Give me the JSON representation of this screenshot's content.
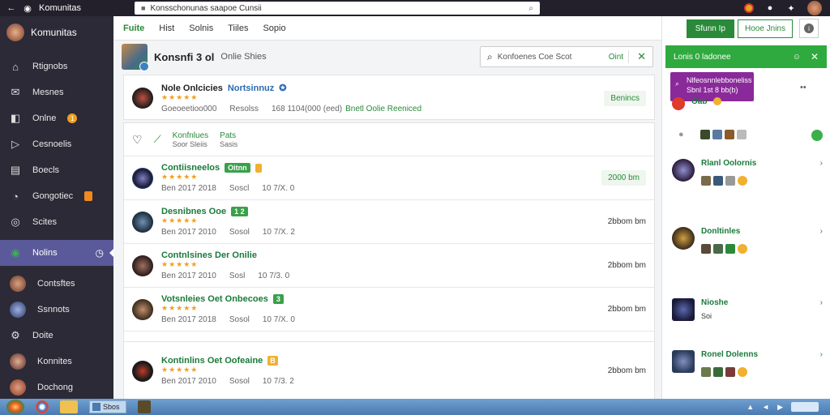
{
  "topbar": {
    "app_title": "Komunitas",
    "url": "Konsschonunas saapoe Cunsii"
  },
  "sidebar": {
    "user_name": "Komunitas",
    "items": [
      {
        "label": "Rtignobs",
        "icon": "home-icon"
      },
      {
        "label": "Mesnes",
        "icon": "message-icon"
      },
      {
        "label": "Onlne",
        "icon": "chat-icon",
        "badge": "1"
      },
      {
        "label": "Cesnoelis",
        "icon": "play-icon"
      },
      {
        "label": "Boecls",
        "icon": "book-icon"
      },
      {
        "label": "Gongotiec",
        "icon": "palette-icon"
      },
      {
        "label": "Scites",
        "icon": "globe-icon"
      },
      {
        "label": "Nolins",
        "icon": "whatsapp-icon",
        "active": true
      },
      {
        "label": "Contsftes",
        "icon": "user-icon"
      },
      {
        "label": "Ssnnots",
        "icon": "user-icon"
      },
      {
        "label": "Doite",
        "icon": "gear-icon"
      },
      {
        "label": "Konnites",
        "icon": "user-icon"
      },
      {
        "label": "Dochong",
        "icon": "user-icon"
      }
    ]
  },
  "main": {
    "tabs": [
      "Fuite",
      "Hist",
      "Solnis",
      "Tiiles",
      "Sopio"
    ],
    "profile": {
      "name": "Konsnfi 3 ol",
      "subtitle": "Onlie Shies"
    },
    "search": {
      "placeholder": "Konfoenes Coe Scot",
      "action": "Oint"
    },
    "feature": {
      "title": "Nole Onlcicies",
      "link": "Nortsinnuz",
      "stars": "★★★★★",
      "meta1": "Goeoeetioo000",
      "meta2": "Resolss",
      "meta3": "168 1104(000 (eed)",
      "highlight": "Bnetl Oolie Reeniced",
      "button": "Benincs"
    },
    "toggle": {
      "a": "Konfnlues",
      "b": "Pats",
      "a_sub": "Soor Sleiis",
      "b_sub": "Sasis"
    },
    "rows": [
      {
        "name": "Contiisneelos",
        "tag": "Oitnn",
        "tag_type": "g",
        "date": "Ben 2017 2018",
        "mid": "Soscl",
        "num": "10 7/X. 0",
        "right": "2000 bm",
        "right_style": "btn"
      },
      {
        "name": "Desnibnes Ooe",
        "tag": "1 2",
        "tag_type": "g",
        "date": "Ben 2017 2010",
        "mid": "Sosol",
        "num": "10 7/X. 2",
        "right": "2bbom bm",
        "right_style": "plain"
      },
      {
        "name": "Contnlsines Der Onilie",
        "tag": "",
        "tag_type": "",
        "date": "Ben 2017 2010",
        "mid": "Sosl",
        "num": "10 7/3. 0",
        "right": "2bbom bm",
        "right_style": "plain"
      },
      {
        "name": "Votsnleies Oet Onbecoes",
        "tag": "3",
        "tag_type": "g",
        "date": "Ben 2017 2018",
        "mid": "Sosol",
        "num": "10 7/X. 0",
        "right": "2bbom bm",
        "right_style": "plain"
      },
      {
        "name": "Kontinlins Oet Oofeaine",
        "tag": "B",
        "tag_type": "o",
        "date": "Ben 2017 2010",
        "mid": "Sosol",
        "num": "10 7/3. 2",
        "right": "2bbom bm",
        "right_style": "plain"
      }
    ]
  },
  "rpanel": {
    "btn_primary": "Sfunn Ip",
    "btn_secondary": "Hooe Jnins",
    "header": "Lonis 0 ladonee",
    "popup_line1": "Nlfeosnnlebboneliss",
    "popup_line2": "Sbnl 1st 8 bb(b)",
    "first_name": "Oab",
    "entries": [
      {
        "name": "Rlanl Oolornis"
      },
      {
        "name": "Donltinles"
      },
      {
        "name": "Nioshe",
        "sub": "Soi"
      },
      {
        "name": "Ronel Dolenns"
      }
    ]
  },
  "taskbar": {
    "window_label": "Sbos"
  }
}
